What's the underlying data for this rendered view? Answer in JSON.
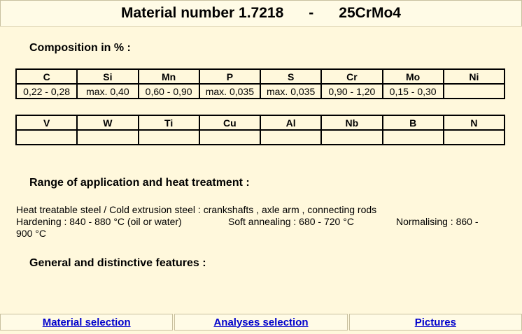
{
  "header": {
    "title": "Material number 1.7218",
    "separator": "-",
    "code": "25CrMo4"
  },
  "composition": {
    "heading": "Composition in % :",
    "row1_headers": [
      "C",
      "Si",
      "Mn",
      "P",
      "S",
      "Cr",
      "Mo",
      "Ni"
    ],
    "row1_values": [
      "0,22 - 0,28",
      "max. 0,40",
      "0,60 - 0,90",
      "max. 0,035",
      "max. 0,035",
      "0,90 - 1,20",
      "0,15 - 0,30",
      ""
    ],
    "row2_headers": [
      "V",
      "W",
      "Ti",
      "Cu",
      "Al",
      "Nb",
      "B",
      "N"
    ],
    "row2_values": [
      "",
      "",
      "",
      "",
      "",
      "",
      "",
      ""
    ]
  },
  "application": {
    "heading": "Range of application and heat treatment :",
    "line1": "Heat treatable steel / Cold extrusion steel : crankshafts , axle arm , connecting rods",
    "hardening": "Hardening : 840 - 880 °C (oil or water)",
    "soft_annealing": "Soft annealing : 680 - 720 °C",
    "normalising": "Normalising : 860 -",
    "normalising_cont": "900 °C"
  },
  "features": {
    "heading": "General and distinctive features :"
  },
  "footer": {
    "material_selection": "Material selection",
    "analyses_selection": "Analyses selection",
    "pictures": "Pictures"
  }
}
